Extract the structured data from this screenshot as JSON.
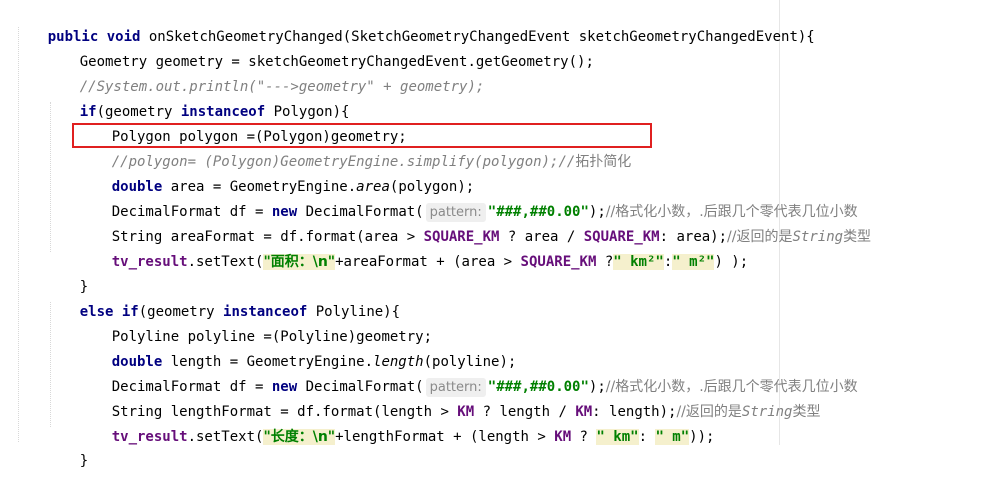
{
  "code": {
    "l1": {
      "kw": "public void",
      "rest": " onSketchGeometryChanged(SketchGeometryChangedEvent sketchGeometryChangedEvent){"
    },
    "l2": "Geometry geometry = sketchGeometryChangedEvent.getGeometry();",
    "l3_comment": "//System.out.println(\"--->geometry\" + geometry);",
    "l4": {
      "kw_if": "if",
      "p1": "(geometry ",
      "kw_instanceof": "instanceof",
      "p2": " Polygon){"
    },
    "l5": "Polygon polygon =(Polygon)geometry;",
    "l6": {
      "comment": "//polygon= (Polygon)GeometryEngine.simplify(polygon);//",
      "cn": "拓扑简化"
    },
    "l7": {
      "kw": "double",
      "p1": " area = GeometryEngine.",
      "method": "area",
      "p2": "(polygon);"
    },
    "l8": {
      "p1": "DecimalFormat df = ",
      "kw": "new",
      "p2": " DecimalFormat(",
      "hint": "pattern:",
      "str": "\"###,##0.00\"",
      "p3": ");",
      "comment": "//格式化小数，.后跟几个零代表几位小数"
    },
    "l9": {
      "p1": "String areaFormat = df.format(area > ",
      "c1": "SQUARE_KM",
      "p2": " ? area / ",
      "c2": "SQUARE_KM",
      "p3": ": area);",
      "comment_a": "//返回的是",
      "comment_b": "String",
      "comment_c": "类型"
    },
    "l10": {
      "field": "tv_result",
      "p1": ".setText(",
      "s1": "\"面积：\\n\"",
      "p2": "+areaFormat + (area > ",
      "c1": "SQUARE_KM",
      "p3": " ?",
      "s2": "\" km²\"",
      "p4": ":",
      "s3": "\" m²\"",
      "p5": ") );"
    },
    "l11": "}",
    "l12": {
      "kw_else": "else if",
      "p1": "(geometry ",
      "kw_instanceof": "instanceof",
      "p2": " Polyline){"
    },
    "l13": "Polyline polyline =(Polyline)geometry;",
    "l14": {
      "kw": "double",
      "p1": " length = GeometryEngine.",
      "method": "length",
      "p2": "(polyline);"
    },
    "l15": {
      "p1": "DecimalFormat df = ",
      "kw": "new",
      "p2": " DecimalFormat(",
      "hint": "pattern:",
      "str": "\"###,##0.00\"",
      "p3": ");",
      "comment": "//格式化小数，.后跟几个零代表几位小数"
    },
    "l16": {
      "p1": "String lengthFormat = df.format(length > ",
      "c1": "KM",
      "p2": " ? length / ",
      "c2": "KM",
      "p3": ": length);",
      "comment_a": "//返回的是",
      "comment_b": "String",
      "comment_c": "类型"
    },
    "l17": {
      "field": "tv_result",
      "p1": ".setText(",
      "s1": "\"长度：\\n\"",
      "p2": "+lengthFormat + (length > ",
      "c1": "KM",
      "p3": " ? ",
      "s2": "\" km\"",
      "p4": ": ",
      "s3": "\" m\"",
      "p5": "));"
    },
    "l18": "}"
  },
  "colors": {
    "keyword": "#000080",
    "comment": "#808080",
    "field": "#660e7a",
    "string": "#008000",
    "highlight_box": "#e02020"
  }
}
